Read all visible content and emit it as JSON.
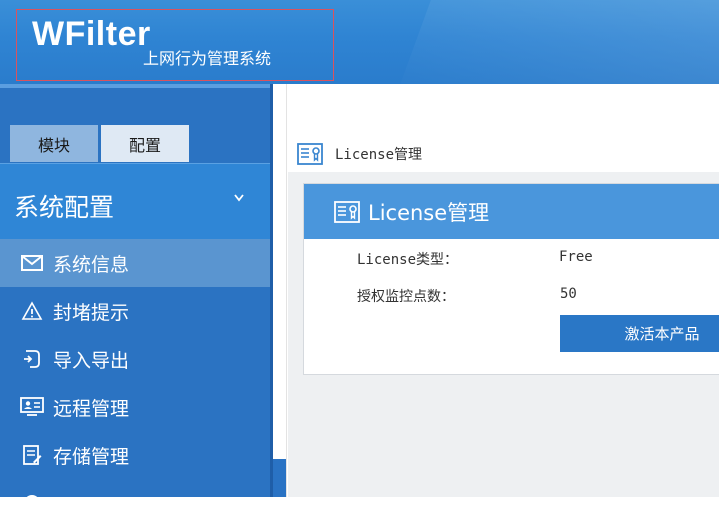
{
  "header": {
    "logo_title": "WFilter",
    "logo_subtitle": "上网行为管理系统"
  },
  "sidebar": {
    "tabs": [
      {
        "label": "模块"
      },
      {
        "label": "配置"
      }
    ],
    "section_title": "系统配置",
    "items": [
      {
        "label": "系统信息",
        "icon": "envelope-icon"
      },
      {
        "label": "封堵提示",
        "icon": "warning-icon"
      },
      {
        "label": "导入导出",
        "icon": "import-export-icon"
      },
      {
        "label": "远程管理",
        "icon": "monitor-user-icon"
      },
      {
        "label": "存储管理",
        "icon": "storage-edit-icon"
      },
      {
        "label": "",
        "icon": "settings-icon"
      }
    ]
  },
  "main": {
    "breadcrumb": "License管理",
    "panel_title": "License管理",
    "rows": [
      {
        "label": "License类型：",
        "value": "Free"
      },
      {
        "label": "授权监控点数：",
        "value": "50"
      }
    ],
    "activate_button": "激活本产品"
  },
  "colors": {
    "header_blue": "#2f84d3",
    "sidebar_blue": "#2b73c2",
    "active_item": "#5a95d0",
    "panel_head": "#4a96dc",
    "button_blue": "#2a77c6"
  }
}
